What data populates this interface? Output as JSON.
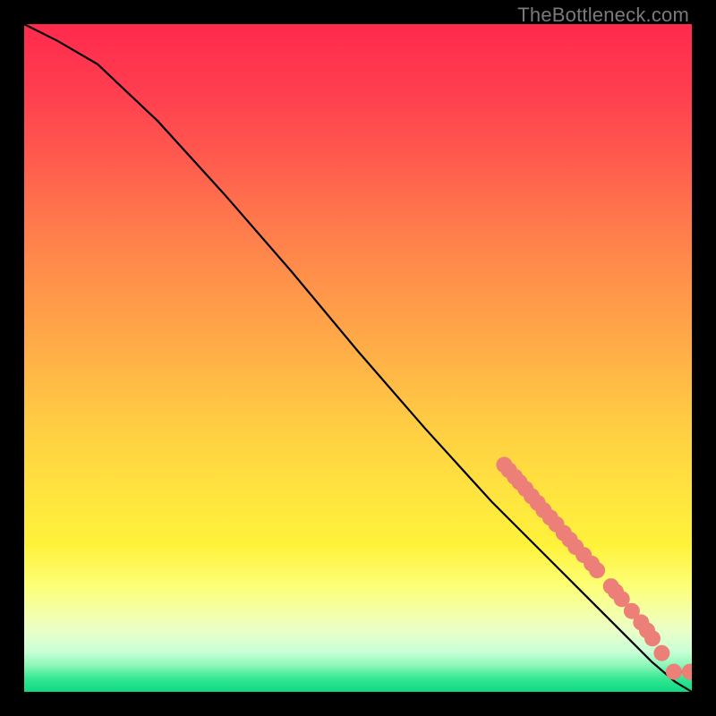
{
  "attribution": "TheBottleneck.com",
  "chart_data": {
    "type": "line",
    "title": "",
    "xlabel": "",
    "ylabel": "",
    "xlim": [
      0,
      1
    ],
    "ylim": [
      0,
      1
    ],
    "curve_anchors": {
      "comment": "normalized (0..1) x,y pairs describing the black curve; y is fraction from top",
      "x": [
        0.0,
        0.05,
        0.11,
        0.2,
        0.3,
        0.4,
        0.5,
        0.6,
        0.7,
        0.8,
        0.88,
        0.94,
        0.975,
        1.0
      ],
      "y": [
        0.0,
        0.025,
        0.06,
        0.145,
        0.255,
        0.37,
        0.49,
        0.605,
        0.715,
        0.815,
        0.895,
        0.955,
        0.985,
        1.0
      ]
    },
    "markers": {
      "comment": "pink-ish circular markers along the lower-right tail of the curve",
      "color": "#ec8078",
      "radius_px": 9,
      "points": [
        {
          "x": 0.719,
          "y": 0.66
        },
        {
          "x": 0.726,
          "y": 0.668
        },
        {
          "x": 0.735,
          "y": 0.678
        },
        {
          "x": 0.742,
          "y": 0.686
        },
        {
          "x": 0.751,
          "y": 0.696
        },
        {
          "x": 0.76,
          "y": 0.707
        },
        {
          "x": 0.769,
          "y": 0.717
        },
        {
          "x": 0.778,
          "y": 0.728
        },
        {
          "x": 0.788,
          "y": 0.739
        },
        {
          "x": 0.797,
          "y": 0.749
        },
        {
          "x": 0.808,
          "y": 0.762
        },
        {
          "x": 0.817,
          "y": 0.772
        },
        {
          "x": 0.826,
          "y": 0.783
        },
        {
          "x": 0.838,
          "y": 0.795
        },
        {
          "x": 0.85,
          "y": 0.808
        },
        {
          "x": 0.858,
          "y": 0.818
        },
        {
          "x": 0.879,
          "y": 0.842
        },
        {
          "x": 0.886,
          "y": 0.85
        },
        {
          "x": 0.895,
          "y": 0.861
        },
        {
          "x": 0.91,
          "y": 0.879
        },
        {
          "x": 0.924,
          "y": 0.896
        },
        {
          "x": 0.933,
          "y": 0.908
        },
        {
          "x": 0.941,
          "y": 0.92
        },
        {
          "x": 0.955,
          "y": 0.942
        },
        {
          "x": 0.973,
          "y": 0.97
        },
        {
          "x": 0.997,
          "y": 0.97
        }
      ]
    }
  }
}
